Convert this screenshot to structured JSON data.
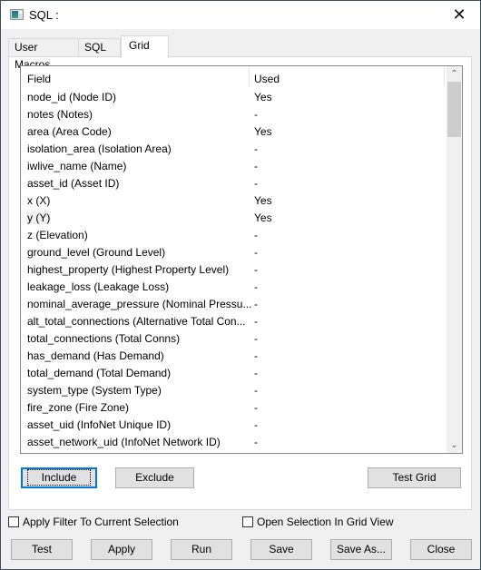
{
  "window": {
    "title": "SQL :",
    "close_symbol": "✕"
  },
  "tabs": [
    {
      "label": "User Macros",
      "active": false
    },
    {
      "label": "SQL",
      "active": false
    },
    {
      "label": "Grid",
      "active": true
    }
  ],
  "grid": {
    "columns": [
      "Field",
      "Used"
    ],
    "rows": [
      {
        "field": "node_id  (Node ID)",
        "used": "Yes"
      },
      {
        "field": "notes  (Notes)",
        "used": "-"
      },
      {
        "field": "area  (Area Code)",
        "used": "Yes"
      },
      {
        "field": "isolation_area  (Isolation Area)",
        "used": "-"
      },
      {
        "field": "iwlive_name  (Name)",
        "used": "-"
      },
      {
        "field": "asset_id  (Asset ID)",
        "used": "-"
      },
      {
        "field": "x  (X)",
        "used": "Yes"
      },
      {
        "field": "y  (Y)",
        "used": "Yes",
        "highlighted": true
      },
      {
        "field": "z  (Elevation)",
        "used": "-"
      },
      {
        "field": "ground_level  (Ground Level)",
        "used": "-"
      },
      {
        "field": "highest_property  (Highest Property Level)",
        "used": "-"
      },
      {
        "field": "leakage_loss  (Leakage Loss)",
        "used": "-"
      },
      {
        "field": "nominal_average_pressure  (Nominal Pressu...",
        "used": "-"
      },
      {
        "field": "alt_total_connections  (Alternative Total Con...",
        "used": "-"
      },
      {
        "field": "total_connections  (Total Conns)",
        "used": "-"
      },
      {
        "field": "has_demand  (Has Demand)",
        "used": "-"
      },
      {
        "field": "total_demand  (Total Demand)",
        "used": "-"
      },
      {
        "field": "system_type  (System Type)",
        "used": "-"
      },
      {
        "field": "fire_zone  (Fire Zone)",
        "used": "-"
      },
      {
        "field": "asset_uid  (InfoNet Unique ID)",
        "used": "-"
      },
      {
        "field": "asset_network_uid  (InfoNet Network ID)",
        "used": "-"
      }
    ],
    "scroll_up_symbol": "⌃",
    "scroll_down_symbol": "⌄"
  },
  "panel_buttons": {
    "include": "Include",
    "exclude": "Exclude",
    "test_grid": "Test Grid"
  },
  "checkboxes": {
    "apply_filter": {
      "label": "Apply Filter To Current Selection",
      "checked": false
    },
    "open_selection": {
      "label": "Open Selection In Grid View",
      "checked": false
    }
  },
  "footer_buttons": {
    "test": "Test",
    "apply": "Apply",
    "run": "Run",
    "save": "Save",
    "save_as": "Save As...",
    "close": "Close"
  },
  "colors": {
    "focus_border": "#0078d7",
    "window_border": "#3c4f63",
    "button_face": "#e1e1e1"
  }
}
